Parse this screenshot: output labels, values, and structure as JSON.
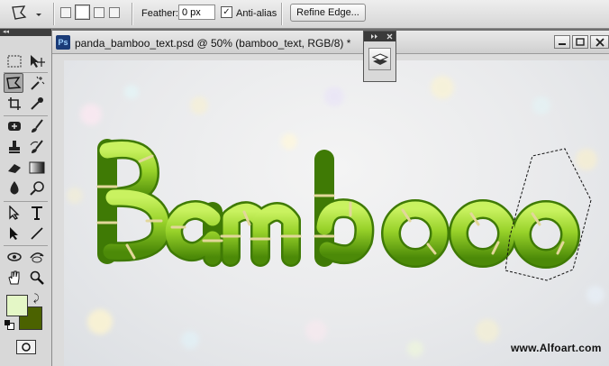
{
  "options_bar": {
    "feather_label": "Feather:",
    "feather_value": "0 px",
    "antialias_label": "Anti-alias",
    "antialias_checked": true,
    "refine_edge_label": "Refine Edge..."
  },
  "toolbox": {
    "header_glyph": "◂◂",
    "tools": [
      "marquee-icon",
      "move-icon",
      "polygonal-lasso-icon",
      "magic-wand-icon",
      "crop-icon",
      "eyedropper-icon",
      "healing-brush-icon",
      "brush-icon",
      "clone-stamp-icon",
      "history-brush-icon",
      "eraser-icon",
      "gradient-icon",
      "dodge-icon",
      "blur-icon",
      "path-selection-icon",
      "type-icon",
      "direct-selection-icon",
      "line-icon",
      "3d-rotate-icon",
      "3d-orbit-icon",
      "hand-icon",
      "zoom-icon"
    ],
    "foreground_color": "#e4f7c6",
    "background_color": "#4b6200"
  },
  "document": {
    "title": "panda_bamboo_text.psd @ 50% (bamboo_text, RGB/8) *",
    "ps_icon_label": "Ps",
    "canvas_text": "Bamboo",
    "watermark": "www.Alfoart.com"
  },
  "colors": {
    "bamboo_light": "#b7e64a",
    "bamboo_dark": "#4f8d08",
    "bamboo_joint": "#e2d79a"
  }
}
